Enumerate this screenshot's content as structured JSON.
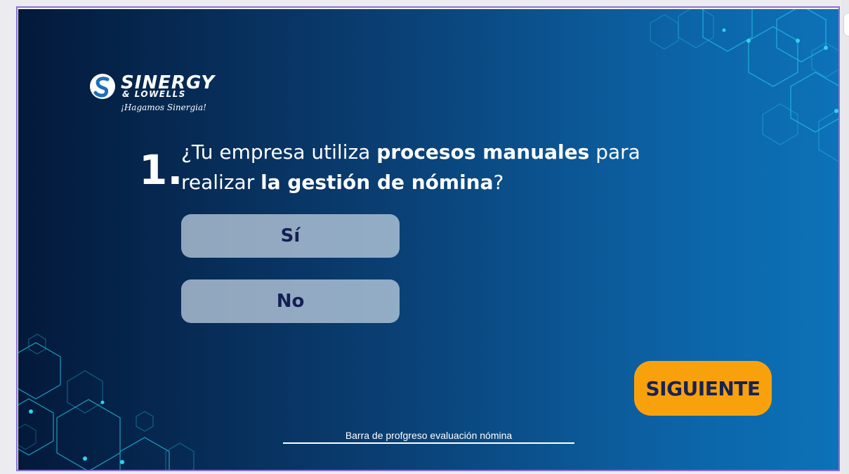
{
  "colors": {
    "slide_start": "#03193a",
    "slide_end": "#0d72b8",
    "option_bg": "#c8d7e6",
    "option_text": "#142054",
    "next_bg": "#f9a10c",
    "next_text": "#172352",
    "hex_line": "#27c7e8",
    "frame_border": "#8a6fd6"
  },
  "logo": {
    "line1": "SINERGY",
    "line2": "& LOWELLS",
    "tagline": "¡Hagamos Sinergia!",
    "icon": "sinergy-swirl-logo-icon"
  },
  "question": {
    "number": "1.",
    "part1": "¿Tu empresa utiliza ",
    "bold1": "procesos manuales",
    "part2": "  para realizar ",
    "bold2": "la gestión de nómina",
    "part3": "?"
  },
  "options": {
    "yes_label": "Sí",
    "no_label": "No"
  },
  "next_button": {
    "label": "SIGUIENTE"
  },
  "progress": {
    "label": "Barra de profgreso evaluación nómina"
  }
}
